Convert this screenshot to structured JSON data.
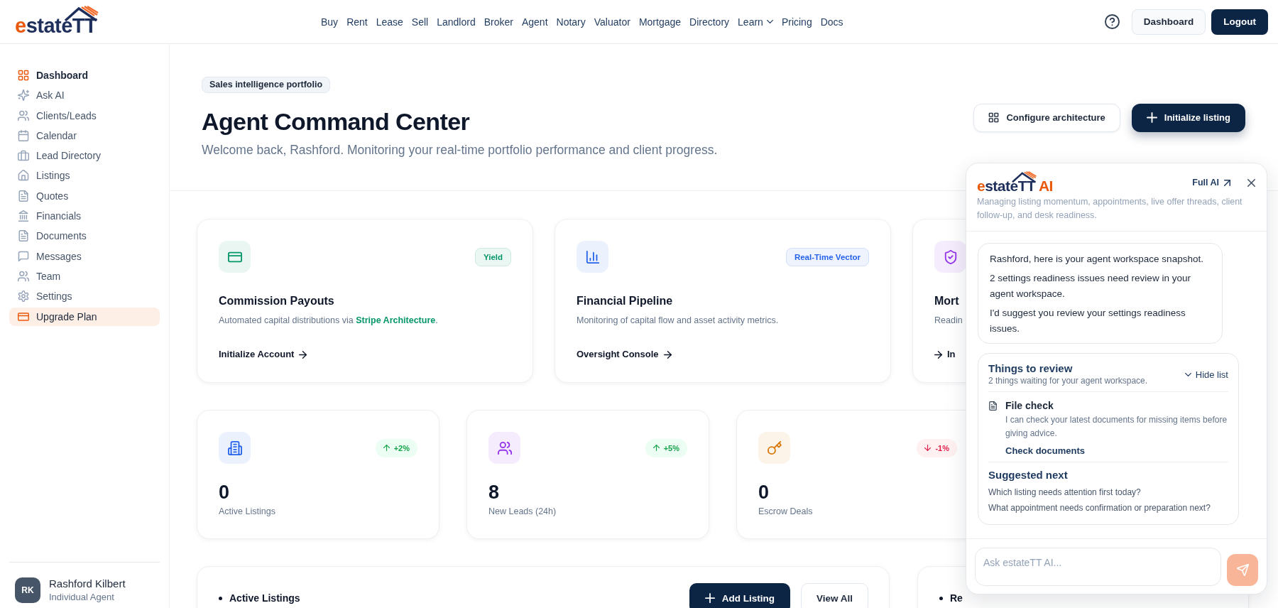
{
  "topbar": {
    "logo": {
      "prefix": "e",
      "name": "stateTT"
    },
    "nav": [
      {
        "label": "Buy",
        "kind": "link"
      },
      {
        "label": "Rent",
        "kind": "link"
      },
      {
        "label": "Lease",
        "kind": "link"
      },
      {
        "label": "Sell",
        "kind": "link"
      },
      {
        "label": "Landlord",
        "kind": "link"
      },
      {
        "label": "Broker",
        "kind": "link"
      },
      {
        "label": "Agent",
        "kind": "link"
      },
      {
        "label": "Notary",
        "kind": "link"
      },
      {
        "label": "Valuator",
        "kind": "link"
      },
      {
        "label": "Mortgage",
        "kind": "link"
      },
      {
        "label": "Directory",
        "kind": "link"
      },
      {
        "label": "Learn",
        "kind": "dropdown"
      },
      {
        "label": "Pricing",
        "kind": "link"
      },
      {
        "label": "Docs",
        "kind": "link"
      }
    ],
    "actions": [
      {
        "label": "Dashboard",
        "kind": "secondary"
      },
      {
        "label": "Logout",
        "kind": "primary"
      }
    ]
  },
  "sidebar": {
    "items": [
      {
        "label": "Dashboard",
        "selected": true,
        "kind": "link"
      },
      {
        "label": "Ask AI",
        "selected": false,
        "kind": "link"
      },
      {
        "label": "Clients/Leads",
        "selected": false,
        "kind": "link"
      },
      {
        "label": "Calendar",
        "selected": false,
        "kind": "link"
      },
      {
        "label": "Lead Directory",
        "selected": false,
        "kind": "link"
      },
      {
        "label": "Listings",
        "selected": false,
        "kind": "link"
      },
      {
        "label": "Quotes",
        "selected": false,
        "kind": "link"
      },
      {
        "label": "Financials",
        "selected": false,
        "kind": "link"
      },
      {
        "label": "Documents",
        "selected": false,
        "kind": "link"
      },
      {
        "label": "Messages",
        "selected": false,
        "kind": "link"
      },
      {
        "label": "Team",
        "selected": false,
        "kind": "link"
      },
      {
        "label": "Settings",
        "selected": false,
        "kind": "link"
      },
      {
        "label": "Upgrade Plan",
        "selected": false,
        "kind": "upgrade"
      }
    ],
    "user": {
      "initials": "RK",
      "name": "Rashford Kilbert",
      "role": "Individual Agent"
    }
  },
  "header": {
    "badge": "Sales intelligence portfolio",
    "title": "Agent Command Center",
    "subtitle": "Welcome back, Rashford. Monitoring your real-time portfolio performance and client progress.",
    "buttons": [
      {
        "label": "Configure architecture",
        "kind": "secondary"
      },
      {
        "label": "Initialize listing",
        "kind": "primary"
      }
    ]
  },
  "feature_cards": [
    {
      "title": "Commission Payouts",
      "description": "Automated capital distributions via **Stripe Architecture**.",
      "badge": "Yield",
      "link": "Initialize Account",
      "kind": "trailing",
      "color": "#059669"
    },
    {
      "title": "Financial Pipeline",
      "description": "Monitoring of capital flow and asset activity metrics.",
      "badge": "Real-Time Vector",
      "link": "Oversight Console",
      "kind": "trailing",
      "color": "#2563eb"
    },
    {
      "title": "Mort",
      "description": "Readin",
      "link": "In",
      "kind": "leading",
      "color": "#9333ea"
    }
  ],
  "stats": [
    {
      "value": "0",
      "label": "Active Listings",
      "change": "+2%",
      "kind": "gain",
      "color": "#2563eb"
    },
    {
      "value": "8",
      "label": "New Leads (24h)",
      "change": "+5%",
      "kind": "gain",
      "color": "#9333ea"
    },
    {
      "value": "0",
      "label": "Escrow Deals",
      "change": "-1%",
      "kind": "loss",
      "color": "#d97706"
    }
  ],
  "panels": [
    {
      "title": "Active Listings",
      "buttons": [
        {
          "label": "Add Listing",
          "kind": "primary"
        },
        {
          "label": "View All",
          "kind": "secondary"
        }
      ]
    },
    {
      "title": "Re"
    }
  ],
  "ai_panel": {
    "logo": {
      "prefix": "e",
      "name": "stateTT",
      "suffix": "AI"
    },
    "full_link": "Full AI",
    "description": "Managing listing momentum, appointments, live offer threads, client follow-up, and desk readiness.",
    "message": [
      "Rashford, here is your agent workspace snapshot.",
      "2 settings readiness issues need review in your agent workspace.",
      "I'd suggest you review your settings readiness issues."
    ],
    "review": {
      "title": "Things to review",
      "subtitle": "2 things waiting for your agent workspace.",
      "toggle": "Hide list",
      "items": [
        {
          "title": "File check",
          "description": "I can check your latest documents for missing items before giving advice.",
          "action": "Check documents"
        }
      ],
      "suggested_title": "Suggested next",
      "suggestions": [
        "Which listing needs attention first today?",
        "What appointment needs confirmation or preparation next?"
      ]
    },
    "input": {
      "placeholder": "Ask estateTT AI..."
    },
    "send_button": {
      "disabled": true
    }
  }
}
